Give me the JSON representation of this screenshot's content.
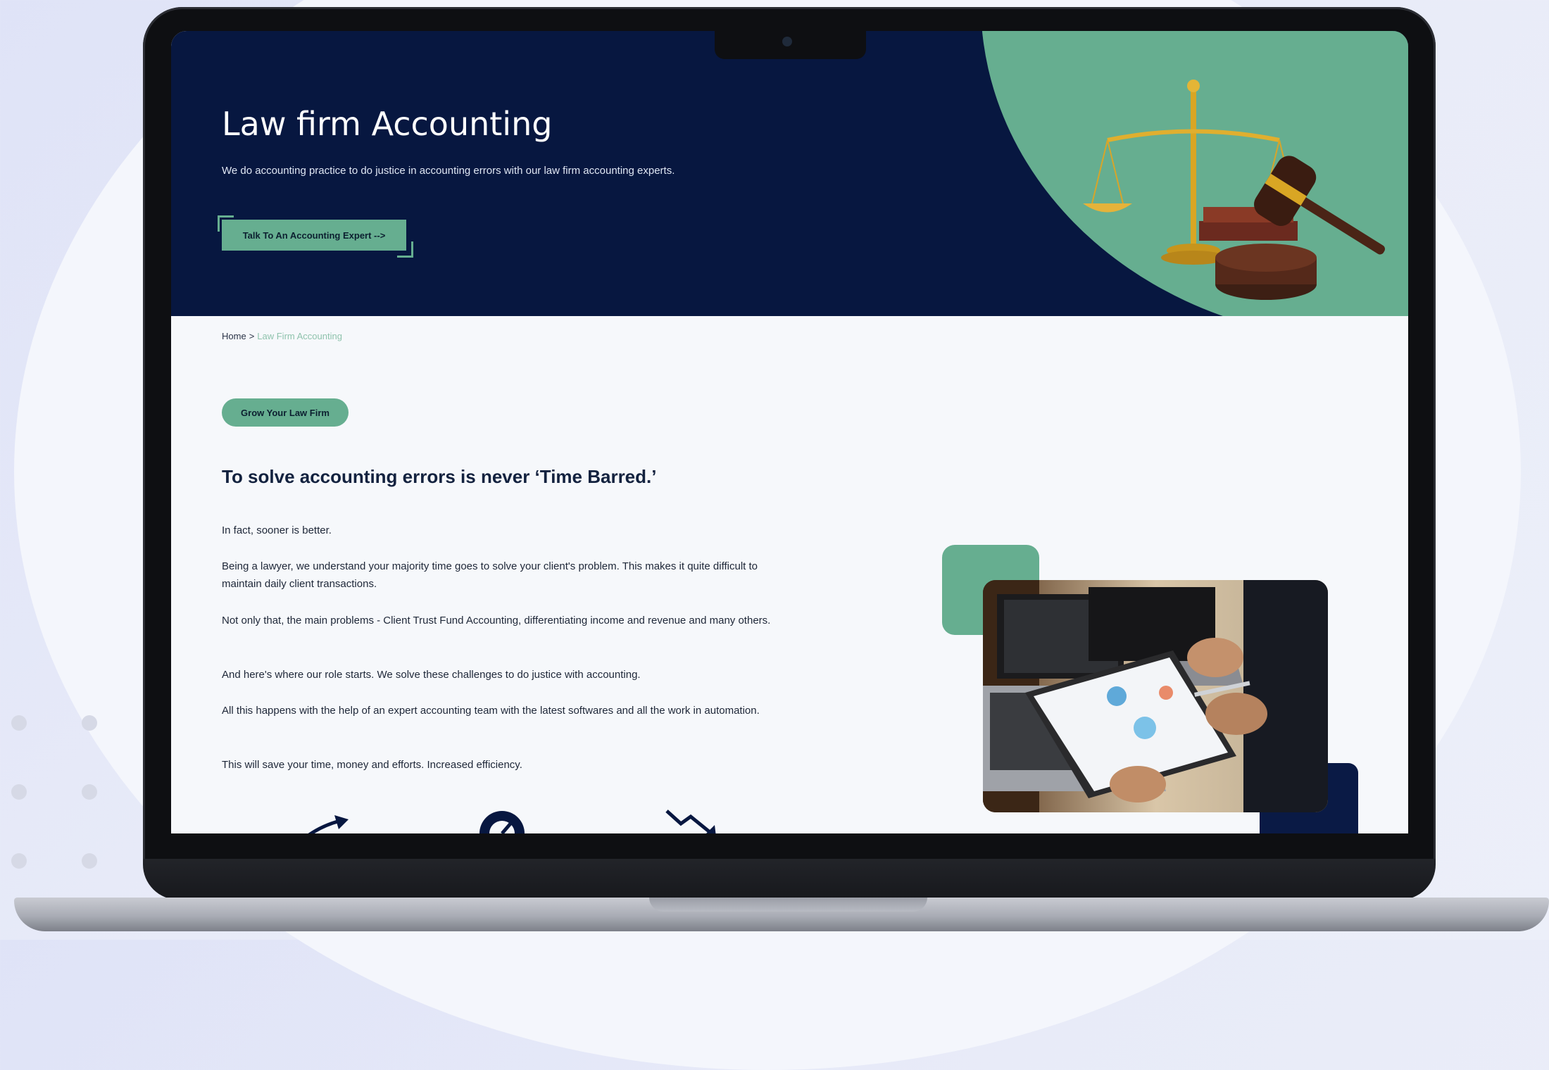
{
  "hero": {
    "title": "Law firm Accounting",
    "subtitle": "We do accounting practice to do justice in accounting errors with our law firm accounting experts.",
    "cta_label": "Talk To An Accounting Expert -->"
  },
  "breadcrumb": {
    "home": "Home",
    "separator": ">",
    "current": "Law Firm Accounting"
  },
  "section": {
    "badge": "Grow Your Law Firm",
    "title": "To solve accounting errors is never ‘Time Barred.’",
    "paragraphs": [
      "In fact, sooner is better.",
      "Being a lawyer, we understand your majority time goes to solve your client's problem. This makes it quite difficult to maintain daily client transactions.",
      "Not only that, the main problems - Client Trust Fund Accounting, differentiating income and revenue and many others.",
      "And here's where our role starts. We solve these challenges to do justice with accounting.",
      "All this happens with the help of an expert accounting team with the latest softwares and all the work in automation.",
      "This will save your time, money and efforts. Increased efficiency."
    ]
  },
  "icons": {
    "hero_image": "scales-of-justice-and-gavel",
    "photo": "business-meeting-documents-laptop",
    "bottom": [
      "growth-arrow-icon",
      "speedometer-gauge-icon",
      "declining-chart-icon"
    ]
  },
  "colors": {
    "navy": "#071740",
    "green": "#66ae90",
    "page_bg": "#f6f8fb",
    "text": "#13223f"
  }
}
